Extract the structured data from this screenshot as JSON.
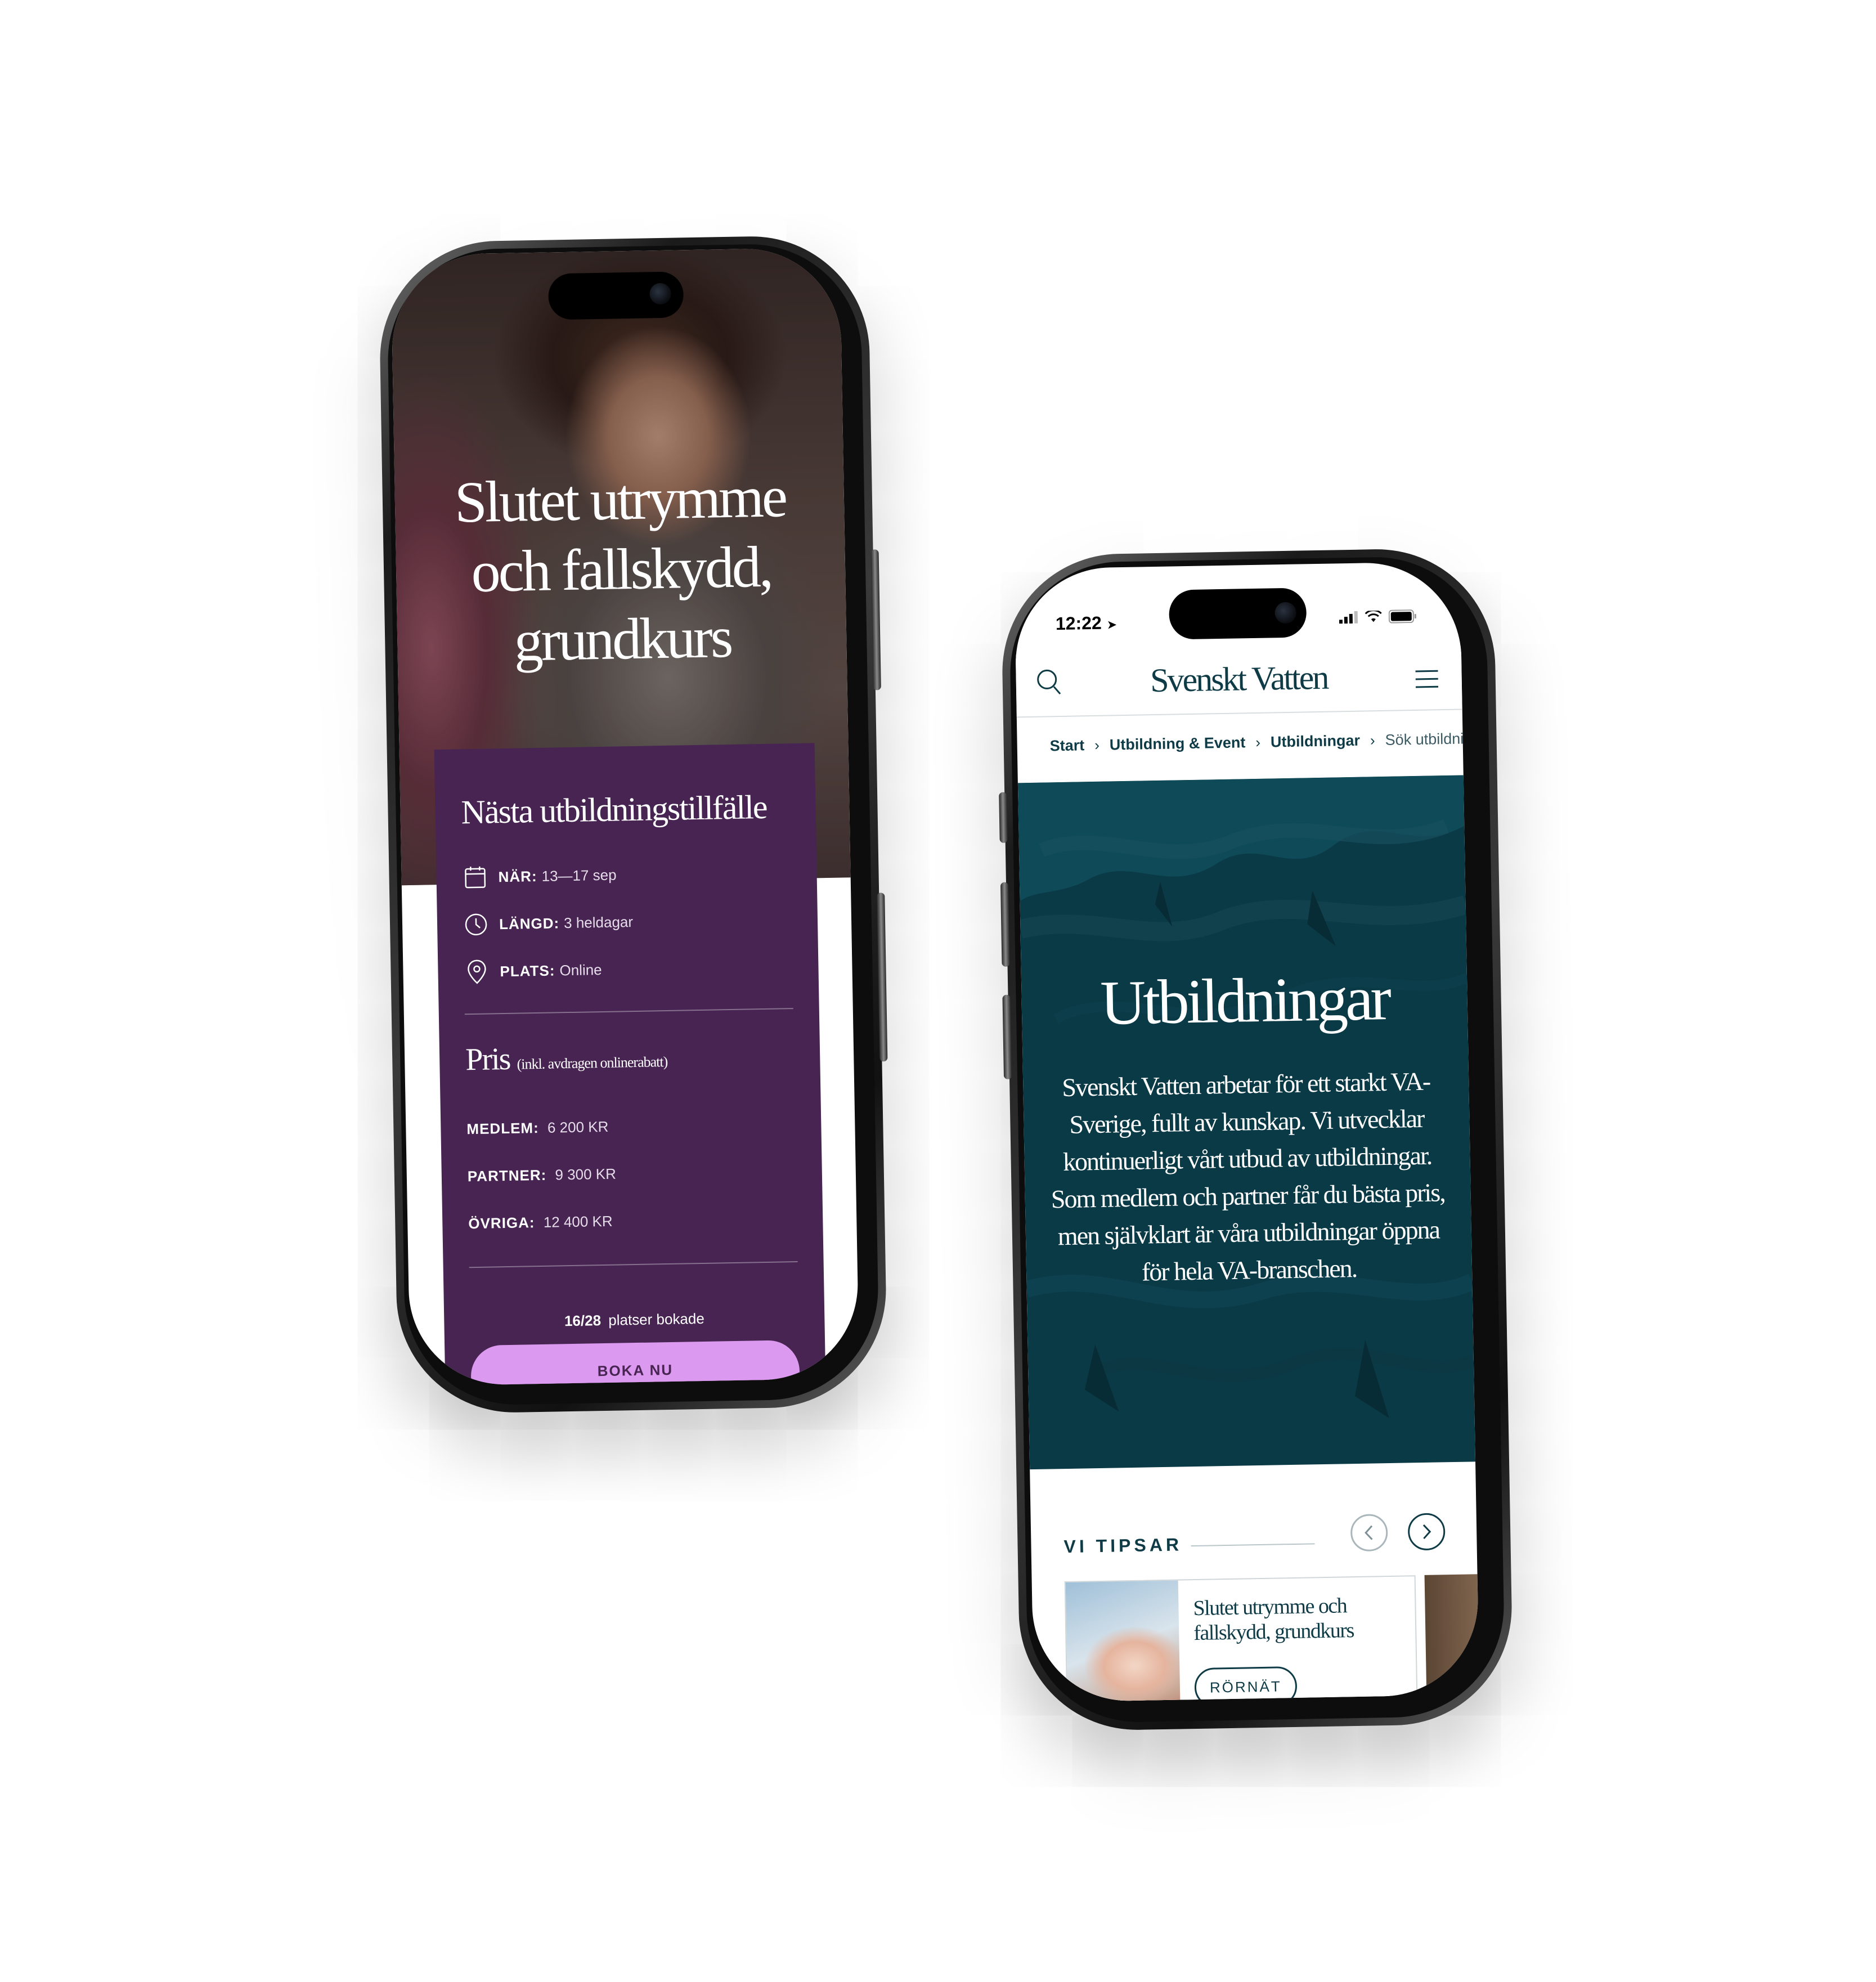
{
  "phone1": {
    "hero_title_lines": [
      "Slutet utrymme",
      "och fallskydd,",
      "grundkurs"
    ],
    "card": {
      "title": "Nästa utbildningstillfälle",
      "when": {
        "label": "NÄR:",
        "value": "13—17 sep"
      },
      "length": {
        "label": "LÄNGD:",
        "value": "3 heldagar"
      },
      "place": {
        "label": "PLATS:",
        "value": "Online"
      },
      "price_title": "Pris",
      "price_subtitle": "(inkl. avdragen onlinerabatt)",
      "prices": [
        {
          "label": "MEDLEM:",
          "value": "6 200 KR"
        },
        {
          "label": "PARTNER:",
          "value": "9 300 KR"
        },
        {
          "label": "ÖVRIGA:",
          "value": "12 400 KR"
        }
      ],
      "booked_count": "16/28",
      "booked_text": "platser bokade",
      "book_button": "BOKA NU"
    },
    "icons": {
      "calendar": "calendar-icon",
      "clock": "clock-icon",
      "pin": "location-pin-icon"
    }
  },
  "phone2": {
    "status_time": "12:22",
    "logo": "Svenskt Vatten",
    "breadcrumbs": [
      "Start",
      "Utbildning & Event",
      "Utbildningar",
      "Sök utbildning"
    ],
    "hero_title": "Utbildningar",
    "hero_text": "Svenskt Vatten arbetar för ett starkt VA-Sverige, fullt av kunskap. Vi utvecklar kontinuerligt vårt utbud av utbildningar. Som medlem och partner får du bästa pris, men självklart är våra utbildningar öppna för hela VA-branschen.",
    "tips_heading": "VI TIPSAR",
    "tip_card": {
      "title": "Slutet utrymme och fallskydd, grundkurs",
      "tag": "RÖRNÄT"
    },
    "colors": {
      "brand": "#0e3b46",
      "hero_bg": "#0a3a46"
    }
  },
  "colors": {
    "card_purple": "#472452",
    "button_pink": "#db9aef"
  }
}
